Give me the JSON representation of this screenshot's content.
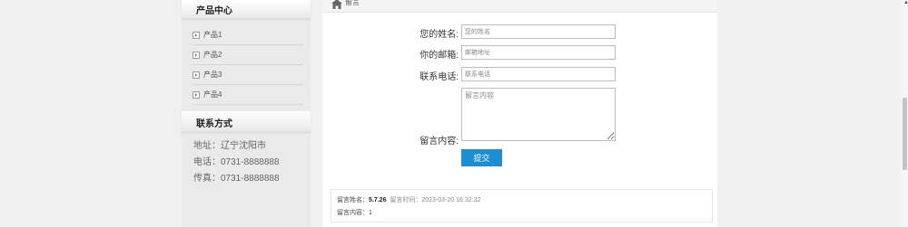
{
  "sidebar": {
    "product_title": "产品中心",
    "products": [
      "产品1",
      "产品2",
      "产品3",
      "产品4"
    ],
    "contact_title": "联系方式",
    "contact": {
      "address": "地址：辽宁沈阳市",
      "phone": "电话：0731-8888888",
      "fax": "传真：0731-8888888"
    }
  },
  "breadcrumb": {
    "label": "留言"
  },
  "form": {
    "name_label": "您的姓名:",
    "name_placeholder": "您的姓名",
    "email_label": "你的邮箱:",
    "email_placeholder": "邮箱地址",
    "phone_label": "联系电话:",
    "phone_placeholder": "联系电话",
    "content_label": "留言内容:",
    "content_placeholder": "留言内容",
    "submit_label": "提交"
  },
  "messages": [
    {
      "name_label": "留言姓名：",
      "name": "5.7.26",
      "time_label": "留言时间：",
      "time": "2023-03-20 16:32:32",
      "content_label": "留言内容：",
      "content": "1"
    }
  ],
  "icons": {
    "home": "home-icon",
    "bullet": "square-bullet-icon"
  },
  "colors": {
    "accent": "#1a8fd4"
  }
}
